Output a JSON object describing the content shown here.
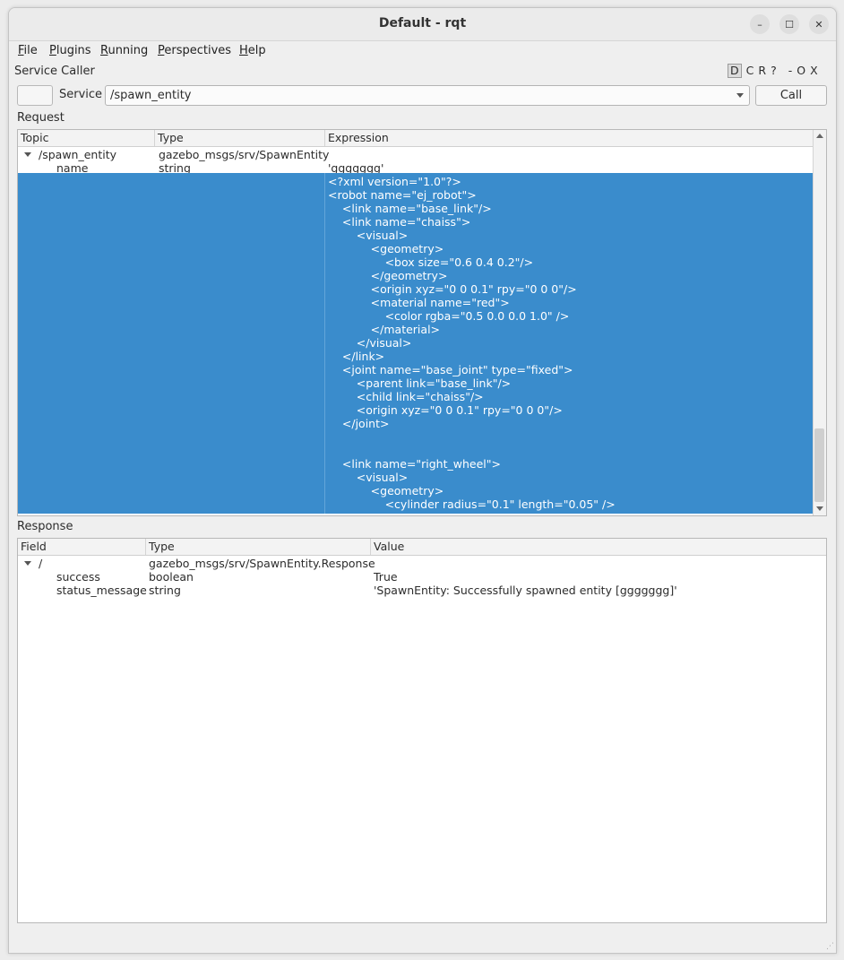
{
  "window": {
    "title": "Default - rqt",
    "controls": {
      "minimize": "–",
      "maximize": "☐",
      "close": "✕"
    }
  },
  "menu": [
    {
      "label": "File",
      "mnemonic": "F",
      "rest": "ile"
    },
    {
      "label": "Plugins",
      "mnemonic": "P",
      "rest": "lugins"
    },
    {
      "label": "Running",
      "mnemonic": "R",
      "rest": "unning"
    },
    {
      "label": "Perspectives",
      "mnemonic": "P",
      "rest": "erspectives"
    },
    {
      "label": "Help",
      "mnemonic": "H",
      "rest": "elp"
    }
  ],
  "plugin": {
    "title": "Service Caller",
    "controls": [
      "D",
      "C",
      "R",
      "?",
      "-",
      "O",
      "X"
    ]
  },
  "service_bar": {
    "label": "Service",
    "selected": "/spawn_entity",
    "call_label": "Call"
  },
  "request": {
    "label": "Request",
    "columns": [
      "Topic",
      "Type",
      "Expression"
    ],
    "root": {
      "topic": "/spawn_entity",
      "type": "gazebo_msgs/srv/SpawnEntity"
    },
    "name_row": {
      "field": "name",
      "type": "string",
      "value": "'ggggggg'"
    },
    "xml_lines": [
      "<?xml version=\"1.0\"?>",
      "<robot name=\"ej_robot\">",
      "    <link name=\"base_link\"/>",
      "    <link name=\"chaiss\">",
      "        <visual>",
      "            <geometry>",
      "                <box size=\"0.6 0.4 0.2\"/>",
      "            </geometry>",
      "            <origin xyz=\"0 0 0.1\" rpy=\"0 0 0\"/>",
      "            <material name=\"red\">",
      "                <color rgba=\"0.5 0.0 0.0 1.0\" />",
      "            </material>",
      "        </visual>",
      "    </link>",
      "    <joint name=\"base_joint\" type=\"fixed\">",
      "        <parent link=\"base_link\"/>",
      "        <child link=\"chaiss\"/>",
      "        <origin xyz=\"0 0 0.1\" rpy=\"0 0 0\"/>",
      "    </joint>",
      "",
      "",
      "    <link name=\"right_wheel\">",
      "        <visual>",
      "            <geometry>",
      "                <cylinder radius=\"0.1\" length=\"0.05\" />"
    ]
  },
  "response": {
    "label": "Response",
    "columns": [
      "Field",
      "Type",
      "Value"
    ],
    "root": {
      "field": "/",
      "type": "gazebo_msgs/srv/SpawnEntity.Response"
    },
    "rows": [
      {
        "field": "success",
        "type": "boolean",
        "value": "True"
      },
      {
        "field": "status_message",
        "type": "string",
        "value": "'SpawnEntity: Successfully spawned entity [ggggggg]'"
      }
    ]
  },
  "colors": {
    "selection": "#3a8ccc",
    "window_bg": "#efefef"
  }
}
